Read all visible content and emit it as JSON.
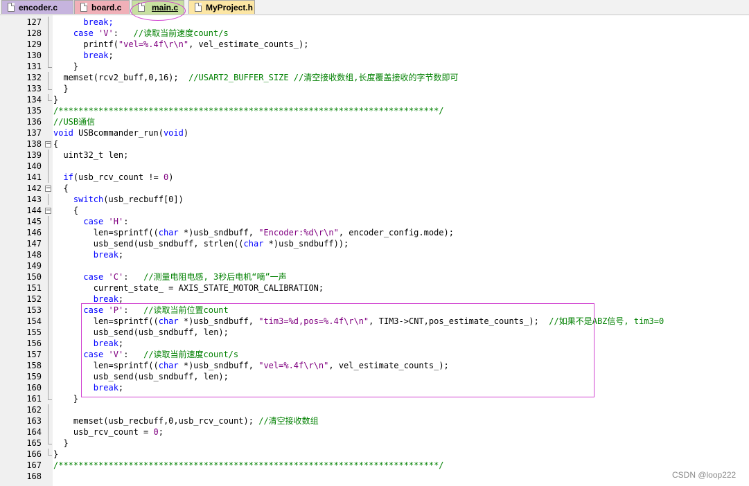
{
  "tabs": [
    {
      "label": "encoder.c",
      "bg": "#c6b4de"
    },
    {
      "label": "board.c",
      "bg": "#f0b0b8"
    },
    {
      "label": "main.c",
      "bg": "#c8e0a0",
      "active": true
    },
    {
      "label": "MyProject.h",
      "bg": "#fce6a4"
    }
  ],
  "colors": {
    "keyword": "#0000ff",
    "string": "#800080",
    "comment": "#008000",
    "highlight": "#d040d0"
  },
  "lines": [
    {
      "n": "127",
      "g": "vl",
      "t": [
        [
          "      break;",
          "k"
        ]
      ]
    },
    {
      "n": "128",
      "g": "vl",
      "t": [
        [
          "    ",
          ""
        ],
        [
          "case",
          "k"
        ],
        [
          " ",
          ""
        ],
        [
          "'V'",
          "s"
        ],
        [
          ":   ",
          ""
        ],
        [
          "//读取当前速度count/s",
          "c"
        ]
      ]
    },
    {
      "n": "129",
      "g": "vl",
      "t": [
        [
          "      printf(",
          ""
        ],
        [
          "\"vel=%.4f\\r\\n\"",
          "s"
        ],
        [
          ", vel_estimate_counts_);",
          ""
        ]
      ]
    },
    {
      "n": "130",
      "g": "vl",
      "t": [
        [
          "      ",
          ""
        ],
        [
          "break",
          "k"
        ],
        [
          ";",
          ""
        ]
      ]
    },
    {
      "n": "131",
      "g": "el",
      "t": [
        [
          "    }",
          ""
        ]
      ]
    },
    {
      "n": "132",
      "g": "vl",
      "t": [
        [
          "  memset(rcv2_buff,0,16);  ",
          ""
        ],
        [
          "//USART2_BUFFER_SIZE //清空接收数组,长度覆盖接收的字节数即可",
          "c"
        ]
      ]
    },
    {
      "n": "133",
      "g": "el",
      "t": [
        [
          "  }",
          ""
        ]
      ]
    },
    {
      "n": "134",
      "g": "el",
      "t": [
        [
          "}",
          ""
        ]
      ]
    },
    {
      "n": "135",
      "g": "",
      "t": [
        [
          "/****************************************************************************/",
          "c"
        ]
      ]
    },
    {
      "n": "136",
      "g": "",
      "t": [
        [
          "//USB通信",
          "c"
        ]
      ]
    },
    {
      "n": "137",
      "g": "",
      "t": [
        [
          "void",
          "k"
        ],
        [
          " USBcommander_run(",
          ""
        ],
        [
          "void",
          "k"
        ],
        [
          ")",
          ""
        ]
      ]
    },
    {
      "n": "138",
      "g": "fold",
      "t": [
        [
          "{",
          ""
        ]
      ]
    },
    {
      "n": "139",
      "g": "vl",
      "t": [
        [
          "  uint32_t len;",
          ""
        ]
      ]
    },
    {
      "n": "140",
      "g": "vl",
      "t": [
        [
          "",
          ""
        ]
      ]
    },
    {
      "n": "141",
      "g": "vl",
      "t": [
        [
          "  ",
          ""
        ],
        [
          "if",
          "k"
        ],
        [
          "(usb_rcv_count != ",
          ""
        ],
        [
          "0",
          "s"
        ],
        [
          ")",
          ""
        ]
      ]
    },
    {
      "n": "142",
      "g": "fold",
      "t": [
        [
          "  {",
          ""
        ]
      ]
    },
    {
      "n": "143",
      "g": "vl",
      "t": [
        [
          "    ",
          ""
        ],
        [
          "switch",
          "k"
        ],
        [
          "(usb_recbuff[0])",
          ""
        ]
      ]
    },
    {
      "n": "144",
      "g": "fold",
      "t": [
        [
          "    {",
          ""
        ]
      ]
    },
    {
      "n": "145",
      "g": "vl",
      "t": [
        [
          "      ",
          ""
        ],
        [
          "case",
          "k"
        ],
        [
          " ",
          ""
        ],
        [
          "'H'",
          "s"
        ],
        [
          ":",
          ""
        ]
      ]
    },
    {
      "n": "146",
      "g": "vl",
      "t": [
        [
          "        len=sprintf((",
          ""
        ],
        [
          "char",
          "k"
        ],
        [
          " *)usb_sndbuff, ",
          ""
        ],
        [
          "\"Encoder:%d\\r\\n\"",
          "s"
        ],
        [
          ", encoder_config.mode);",
          ""
        ]
      ]
    },
    {
      "n": "147",
      "g": "vl",
      "t": [
        [
          "        usb_send(usb_sndbuff, strlen((",
          ""
        ],
        [
          "char",
          "k"
        ],
        [
          " *)usb_sndbuff));",
          ""
        ]
      ]
    },
    {
      "n": "148",
      "g": "vl",
      "t": [
        [
          "        ",
          ""
        ],
        [
          "break",
          "k"
        ],
        [
          ";",
          ""
        ]
      ]
    },
    {
      "n": "149",
      "g": "vl",
      "t": [
        [
          "",
          ""
        ]
      ]
    },
    {
      "n": "150",
      "g": "vl",
      "t": [
        [
          "      ",
          ""
        ],
        [
          "case",
          "k"
        ],
        [
          " ",
          ""
        ],
        [
          "'C'",
          "s"
        ],
        [
          ":   ",
          ""
        ],
        [
          "//测量电阻电感, 3秒后电机“嘀”一声",
          "c"
        ]
      ]
    },
    {
      "n": "151",
      "g": "vl",
      "t": [
        [
          "        current_state_ = AXIS_STATE_MOTOR_CALIBRATION;",
          ""
        ]
      ]
    },
    {
      "n": "152",
      "g": "vl",
      "t": [
        [
          "        ",
          ""
        ],
        [
          "break",
          "k"
        ],
        [
          ";",
          ""
        ]
      ]
    },
    {
      "n": "153",
      "g": "vl",
      "t": [
        [
          "      ",
          ""
        ],
        [
          "case",
          "k"
        ],
        [
          " ",
          ""
        ],
        [
          "'P'",
          "s"
        ],
        [
          ":   ",
          ""
        ],
        [
          "//读取当前位置count",
          "c"
        ]
      ]
    },
    {
      "n": "154",
      "g": "vl",
      "t": [
        [
          "        len=sprintf((",
          ""
        ],
        [
          "char",
          "k"
        ],
        [
          " *)usb_sndbuff, ",
          ""
        ],
        [
          "\"tim3=%d,pos=%.4f\\r\\n\"",
          "s"
        ],
        [
          ", TIM3->CNT,pos_estimate_counts_);  ",
          ""
        ],
        [
          "//如果不是ABZ信号, tim3=0",
          "c"
        ]
      ]
    },
    {
      "n": "155",
      "g": "vl",
      "t": [
        [
          "        usb_send(usb_sndbuff, len);",
          ""
        ]
      ]
    },
    {
      "n": "156",
      "g": "vl",
      "t": [
        [
          "        ",
          ""
        ],
        [
          "break",
          "k"
        ],
        [
          ";",
          ""
        ]
      ]
    },
    {
      "n": "157",
      "g": "vl",
      "t": [
        [
          "      ",
          ""
        ],
        [
          "case",
          "k"
        ],
        [
          " ",
          ""
        ],
        [
          "'V'",
          "s"
        ],
        [
          ":   ",
          ""
        ],
        [
          "//读取当前速度count/s",
          "c"
        ]
      ]
    },
    {
      "n": "158",
      "g": "vl",
      "t": [
        [
          "        len=sprintf((",
          ""
        ],
        [
          "char",
          "k"
        ],
        [
          " *)usb_sndbuff, ",
          ""
        ],
        [
          "\"vel=%.4f\\r\\n\"",
          "s"
        ],
        [
          ", vel_estimate_counts_);",
          ""
        ]
      ]
    },
    {
      "n": "159",
      "g": "vl",
      "t": [
        [
          "        usb_send(usb_sndbuff, len);",
          ""
        ]
      ]
    },
    {
      "n": "160",
      "g": "vl",
      "t": [
        [
          "        ",
          ""
        ],
        [
          "break",
          "k"
        ],
        [
          ";",
          ""
        ]
      ]
    },
    {
      "n": "161",
      "g": "el",
      "t": [
        [
          "    }",
          ""
        ]
      ]
    },
    {
      "n": "162",
      "g": "vl",
      "t": [
        [
          "",
          ""
        ]
      ]
    },
    {
      "n": "163",
      "g": "vl",
      "t": [
        [
          "    memset(usb_recbuff,0,usb_rcv_count); ",
          ""
        ],
        [
          "//清空接收数组",
          "c"
        ]
      ]
    },
    {
      "n": "164",
      "g": "vl",
      "t": [
        [
          "    usb_rcv_count = ",
          ""
        ],
        [
          "0",
          "s"
        ],
        [
          ";",
          ""
        ]
      ]
    },
    {
      "n": "165",
      "g": "el",
      "t": [
        [
          "  }",
          ""
        ]
      ]
    },
    {
      "n": "166",
      "g": "el",
      "t": [
        [
          "}",
          ""
        ]
      ]
    },
    {
      "n": "167",
      "g": "",
      "t": [
        [
          "/****************************************************************************/",
          "c"
        ]
      ]
    },
    {
      "n": "168",
      "g": "",
      "t": [
        [
          "",
          ""
        ]
      ]
    }
  ],
  "watermark": "CSDN @loop222"
}
